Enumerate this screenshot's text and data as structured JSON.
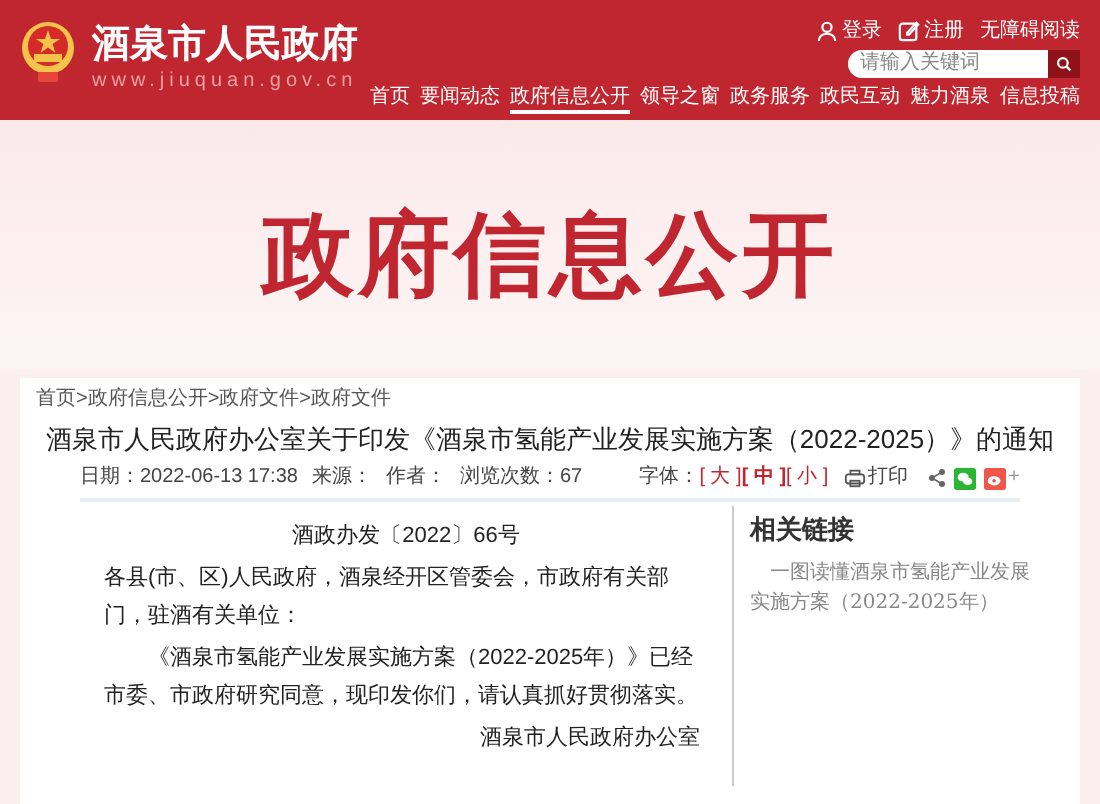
{
  "header": {
    "site_title": "酒泉市人民政府",
    "site_url": "www.jiuquan.gov.cn",
    "top_links": [
      {
        "label": "登录",
        "kind": "user"
      },
      {
        "label": "注册",
        "kind": "edit"
      },
      {
        "label": "无障碍阅读",
        "kind": "plain"
      }
    ],
    "search": {
      "placeholder": "请输入关键词"
    },
    "nav": [
      {
        "label": "首页",
        "selected": false
      },
      {
        "label": "要闻动态",
        "selected": false
      },
      {
        "label": "政府信息公开",
        "selected": true
      },
      {
        "label": "领导之窗",
        "selected": false
      },
      {
        "label": "政务服务",
        "selected": false
      },
      {
        "label": "政民互动",
        "selected": false
      },
      {
        "label": "魅力酒泉",
        "selected": false
      },
      {
        "label": "信息投稿",
        "selected": false
      }
    ]
  },
  "banner": {
    "title": "政府信息公开"
  },
  "breadcrumb": "首页>政府信息公开>政府文件>政府文件",
  "article": {
    "title": "酒泉市人民政府办公室关于印发《酒泉市氢能产业发展实施方案（2022-2025）》的通知",
    "meta": [
      "日期：2022-06-13 17:38",
      "来源：",
      "作者：",
      "浏览次数：67"
    ],
    "font_label": "字体：",
    "font_sizes": [
      {
        "label": "[ 大 ]",
        "selected": false
      },
      {
        "label": "[ 中 ]",
        "selected": true
      },
      {
        "label": "[ 小 ]",
        "selected": false
      }
    ],
    "print": "打印",
    "share_more": "+",
    "doc_number": "酒政办发〔2022〕66号",
    "addressee": "各县(市、区)人民政府，酒泉经开区管委会，市政府有关部门，驻酒有关单位：",
    "paragraph": "《酒泉市氢能产业发展实施方案（2022-2025年）》已经市委、市政府研究同意，现印发你们，请认真抓好贯彻落实。",
    "signature": "酒泉市人民政府办公室"
  },
  "sidebar": {
    "heading": "相关链接",
    "links": [
      "一图读懂酒泉市氢能产业发展实施方案（2022-2025年）"
    ]
  }
}
